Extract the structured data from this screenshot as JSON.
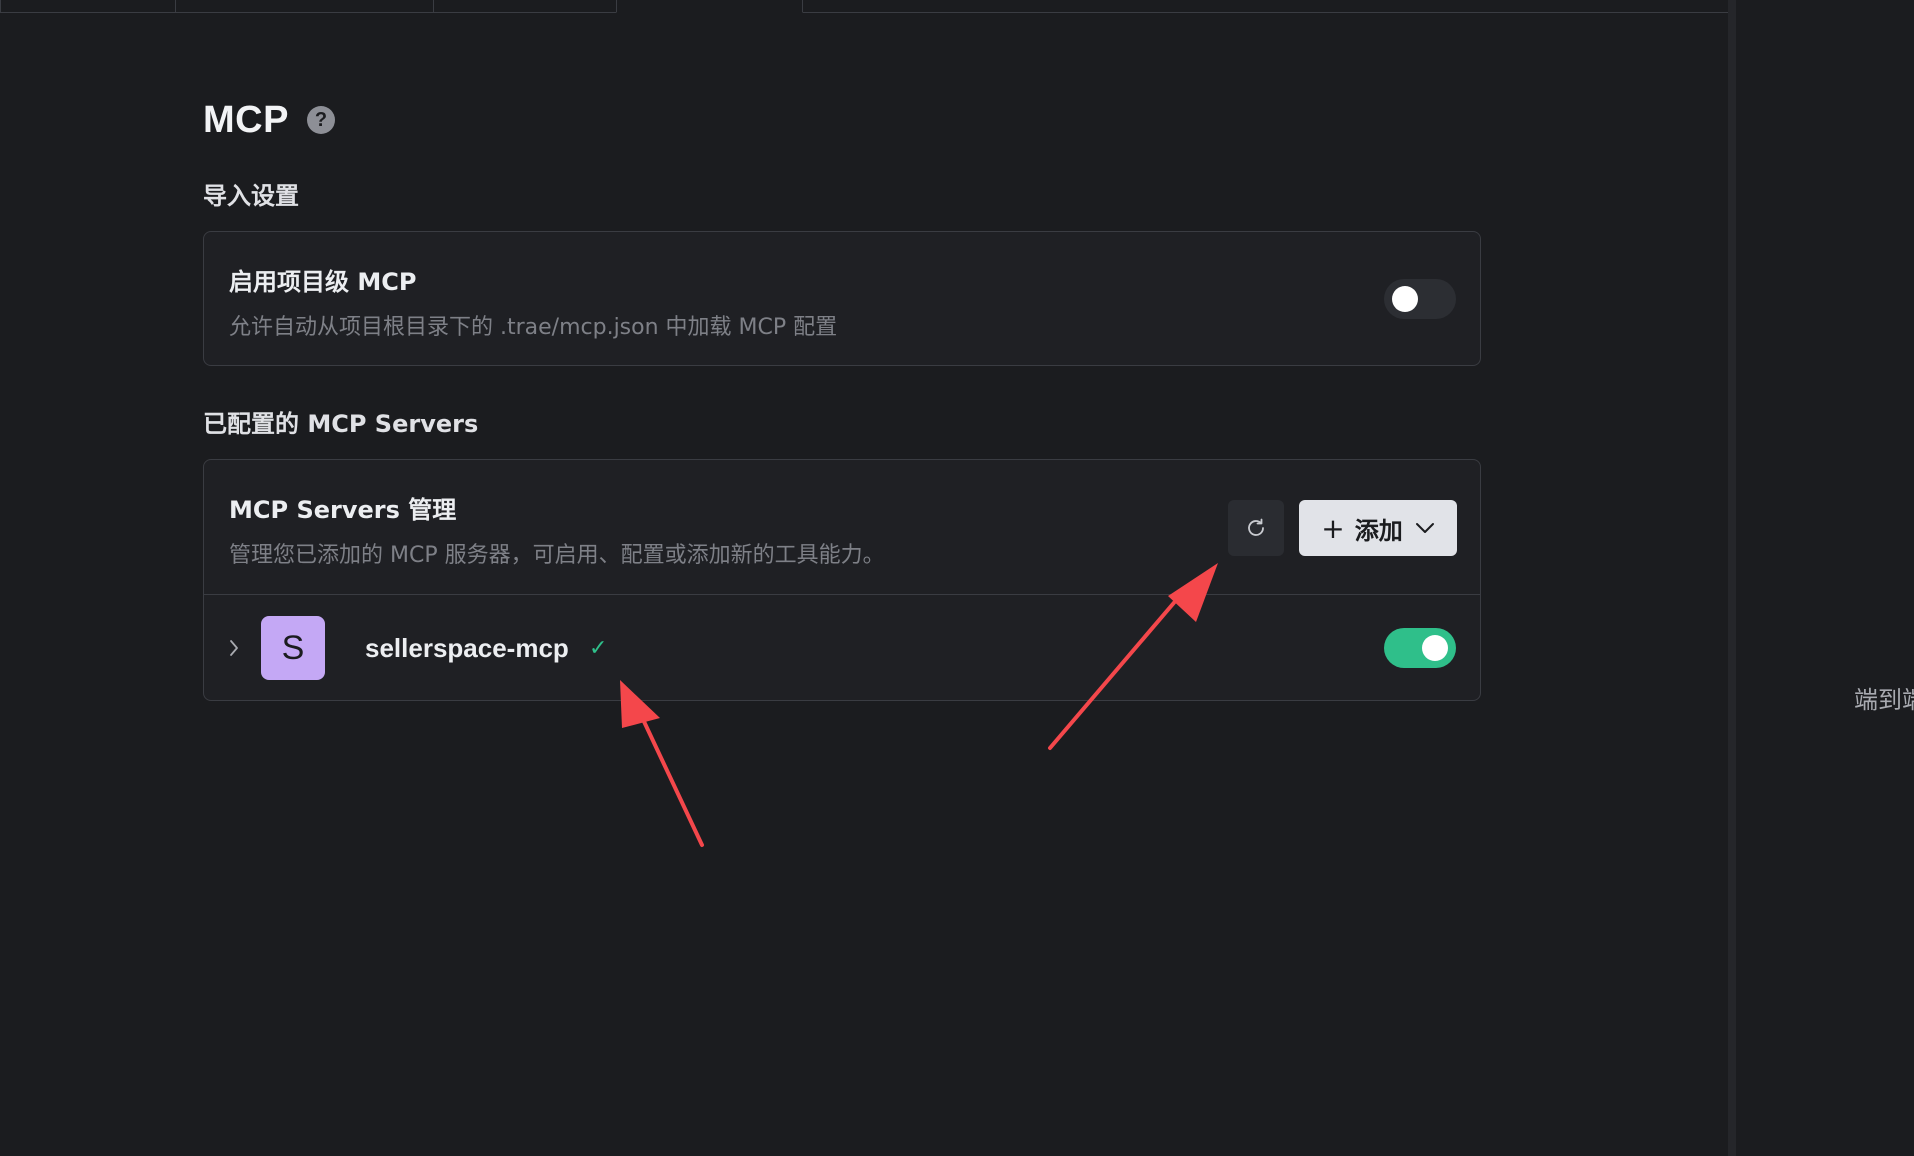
{
  "header": {
    "title": "MCP",
    "help_icon": "question-circle-icon"
  },
  "import_settings": {
    "section_label": "导入设置",
    "project_mcp": {
      "title": "启用项目级 MCP",
      "description": "允许自动从项目根目录下的 .trae/mcp.json 中加载 MCP 配置",
      "enabled": false
    }
  },
  "configured_servers": {
    "section_label": "已配置的 MCP Servers",
    "manage": {
      "title": "MCP Servers 管理",
      "description": "管理您已添加的 MCP 服务器，可启用、配置或添加新的工具能力。",
      "refresh_icon": "refresh-icon",
      "add_plus": "+",
      "add_label": "添加"
    },
    "servers": [
      {
        "avatar_letter": "S",
        "name": "sellerspace-mcp",
        "status": "✓",
        "enabled": true
      }
    ]
  },
  "right_panel": {
    "text": "端到端"
  },
  "colors": {
    "background": "#1b1c1f",
    "card": "#1f2024",
    "toggle_on": "#2fbf8a",
    "avatar": "#c4a8f5",
    "annotation_arrow": "#f4474b"
  }
}
